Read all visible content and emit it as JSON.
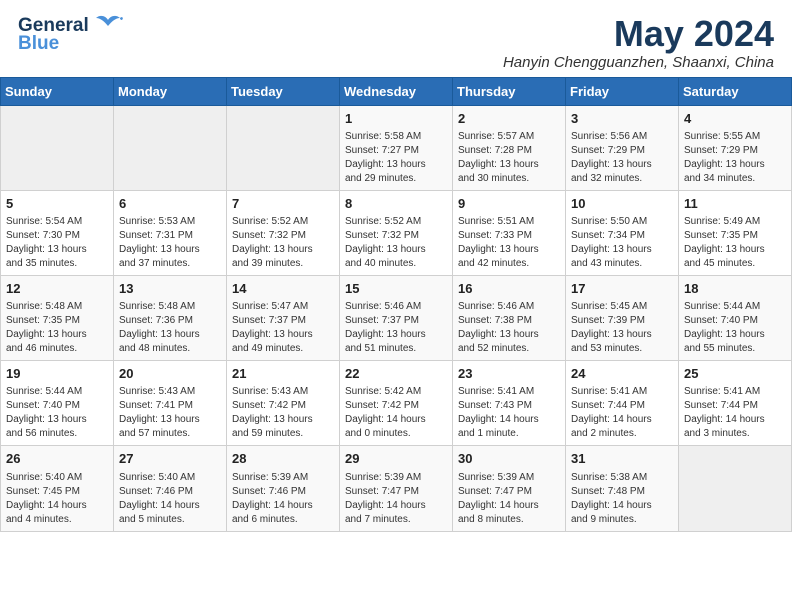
{
  "header": {
    "logo_line1": "General",
    "logo_line2": "Blue",
    "month_year": "May 2024",
    "location": "Hanyin Chengguanzhen, Shaanxi, China"
  },
  "days_of_week": [
    "Sunday",
    "Monday",
    "Tuesday",
    "Wednesday",
    "Thursday",
    "Friday",
    "Saturday"
  ],
  "weeks": [
    [
      {
        "day": "",
        "info": ""
      },
      {
        "day": "",
        "info": ""
      },
      {
        "day": "",
        "info": ""
      },
      {
        "day": "1",
        "info": "Sunrise: 5:58 AM\nSunset: 7:27 PM\nDaylight: 13 hours\nand 29 minutes."
      },
      {
        "day": "2",
        "info": "Sunrise: 5:57 AM\nSunset: 7:28 PM\nDaylight: 13 hours\nand 30 minutes."
      },
      {
        "day": "3",
        "info": "Sunrise: 5:56 AM\nSunset: 7:29 PM\nDaylight: 13 hours\nand 32 minutes."
      },
      {
        "day": "4",
        "info": "Sunrise: 5:55 AM\nSunset: 7:29 PM\nDaylight: 13 hours\nand 34 minutes."
      }
    ],
    [
      {
        "day": "5",
        "info": "Sunrise: 5:54 AM\nSunset: 7:30 PM\nDaylight: 13 hours\nand 35 minutes."
      },
      {
        "day": "6",
        "info": "Sunrise: 5:53 AM\nSunset: 7:31 PM\nDaylight: 13 hours\nand 37 minutes."
      },
      {
        "day": "7",
        "info": "Sunrise: 5:52 AM\nSunset: 7:32 PM\nDaylight: 13 hours\nand 39 minutes."
      },
      {
        "day": "8",
        "info": "Sunrise: 5:52 AM\nSunset: 7:32 PM\nDaylight: 13 hours\nand 40 minutes."
      },
      {
        "day": "9",
        "info": "Sunrise: 5:51 AM\nSunset: 7:33 PM\nDaylight: 13 hours\nand 42 minutes."
      },
      {
        "day": "10",
        "info": "Sunrise: 5:50 AM\nSunset: 7:34 PM\nDaylight: 13 hours\nand 43 minutes."
      },
      {
        "day": "11",
        "info": "Sunrise: 5:49 AM\nSunset: 7:35 PM\nDaylight: 13 hours\nand 45 minutes."
      }
    ],
    [
      {
        "day": "12",
        "info": "Sunrise: 5:48 AM\nSunset: 7:35 PM\nDaylight: 13 hours\nand 46 minutes."
      },
      {
        "day": "13",
        "info": "Sunrise: 5:48 AM\nSunset: 7:36 PM\nDaylight: 13 hours\nand 48 minutes."
      },
      {
        "day": "14",
        "info": "Sunrise: 5:47 AM\nSunset: 7:37 PM\nDaylight: 13 hours\nand 49 minutes."
      },
      {
        "day": "15",
        "info": "Sunrise: 5:46 AM\nSunset: 7:37 PM\nDaylight: 13 hours\nand 51 minutes."
      },
      {
        "day": "16",
        "info": "Sunrise: 5:46 AM\nSunset: 7:38 PM\nDaylight: 13 hours\nand 52 minutes."
      },
      {
        "day": "17",
        "info": "Sunrise: 5:45 AM\nSunset: 7:39 PM\nDaylight: 13 hours\nand 53 minutes."
      },
      {
        "day": "18",
        "info": "Sunrise: 5:44 AM\nSunset: 7:40 PM\nDaylight: 13 hours\nand 55 minutes."
      }
    ],
    [
      {
        "day": "19",
        "info": "Sunrise: 5:44 AM\nSunset: 7:40 PM\nDaylight: 13 hours\nand 56 minutes."
      },
      {
        "day": "20",
        "info": "Sunrise: 5:43 AM\nSunset: 7:41 PM\nDaylight: 13 hours\nand 57 minutes."
      },
      {
        "day": "21",
        "info": "Sunrise: 5:43 AM\nSunset: 7:42 PM\nDaylight: 13 hours\nand 59 minutes."
      },
      {
        "day": "22",
        "info": "Sunrise: 5:42 AM\nSunset: 7:42 PM\nDaylight: 14 hours\nand 0 minutes."
      },
      {
        "day": "23",
        "info": "Sunrise: 5:41 AM\nSunset: 7:43 PM\nDaylight: 14 hours\nand 1 minute."
      },
      {
        "day": "24",
        "info": "Sunrise: 5:41 AM\nSunset: 7:44 PM\nDaylight: 14 hours\nand 2 minutes."
      },
      {
        "day": "25",
        "info": "Sunrise: 5:41 AM\nSunset: 7:44 PM\nDaylight: 14 hours\nand 3 minutes."
      }
    ],
    [
      {
        "day": "26",
        "info": "Sunrise: 5:40 AM\nSunset: 7:45 PM\nDaylight: 14 hours\nand 4 minutes."
      },
      {
        "day": "27",
        "info": "Sunrise: 5:40 AM\nSunset: 7:46 PM\nDaylight: 14 hours\nand 5 minutes."
      },
      {
        "day": "28",
        "info": "Sunrise: 5:39 AM\nSunset: 7:46 PM\nDaylight: 14 hours\nand 6 minutes."
      },
      {
        "day": "29",
        "info": "Sunrise: 5:39 AM\nSunset: 7:47 PM\nDaylight: 14 hours\nand 7 minutes."
      },
      {
        "day": "30",
        "info": "Sunrise: 5:39 AM\nSunset: 7:47 PM\nDaylight: 14 hours\nand 8 minutes."
      },
      {
        "day": "31",
        "info": "Sunrise: 5:38 AM\nSunset: 7:48 PM\nDaylight: 14 hours\nand 9 minutes."
      },
      {
        "day": "",
        "info": ""
      }
    ]
  ]
}
